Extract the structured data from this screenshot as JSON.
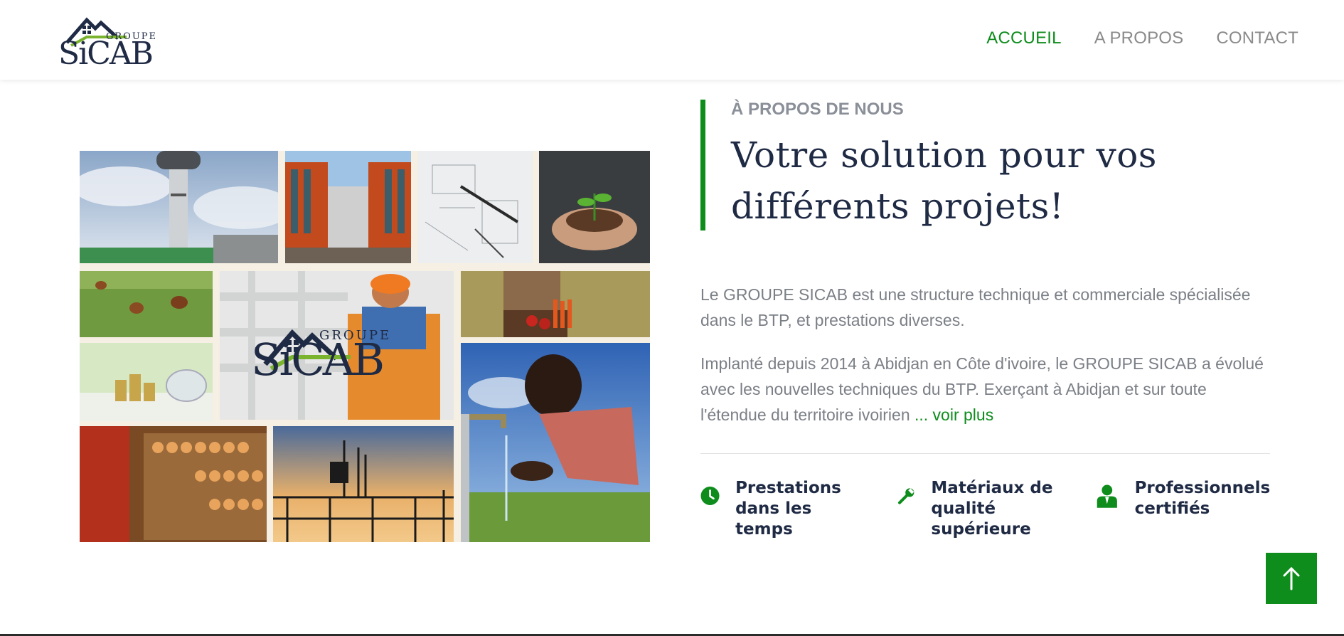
{
  "brand": {
    "groupe": "GROUPE",
    "name": "SiCAB"
  },
  "nav": {
    "home": "ACCUEIL",
    "about": "A PROPOS",
    "contact": "CONTACT"
  },
  "collage": {
    "overlay_logo": {
      "groupe": "GROUPE",
      "name": "SiCAB"
    }
  },
  "about": {
    "eyebrow": "À PROPOS DE NOUS",
    "heading_line1": "Votre solution pour vos",
    "heading_line2": "différents projets!",
    "paragraph1": "Le GROUPE SICAB est une structure technique et commerciale spécialisée dans le BTP, et prestations diverses.",
    "paragraph2": "Implanté depuis 2014 à Abidjan en Côte d'ivoire, le GROUPE SICAB a évolué avec les nouvelles techniques du BTP. Exerçant à Abidjan et sur toute l'étendue du territoire ivoirien",
    "more_link": "... voir plus"
  },
  "features": [
    {
      "icon": "clock-icon",
      "label": "Prestations dans les temps"
    },
    {
      "icon": "wrench-icon",
      "label": "Matériaux de qualité supérieure"
    },
    {
      "icon": "professional-icon",
      "label": "Professionnels certifiés"
    }
  ],
  "colors": {
    "accent": "#0e8c1c",
    "navy": "#1f2a44",
    "text_gray": "#7b7f86"
  }
}
